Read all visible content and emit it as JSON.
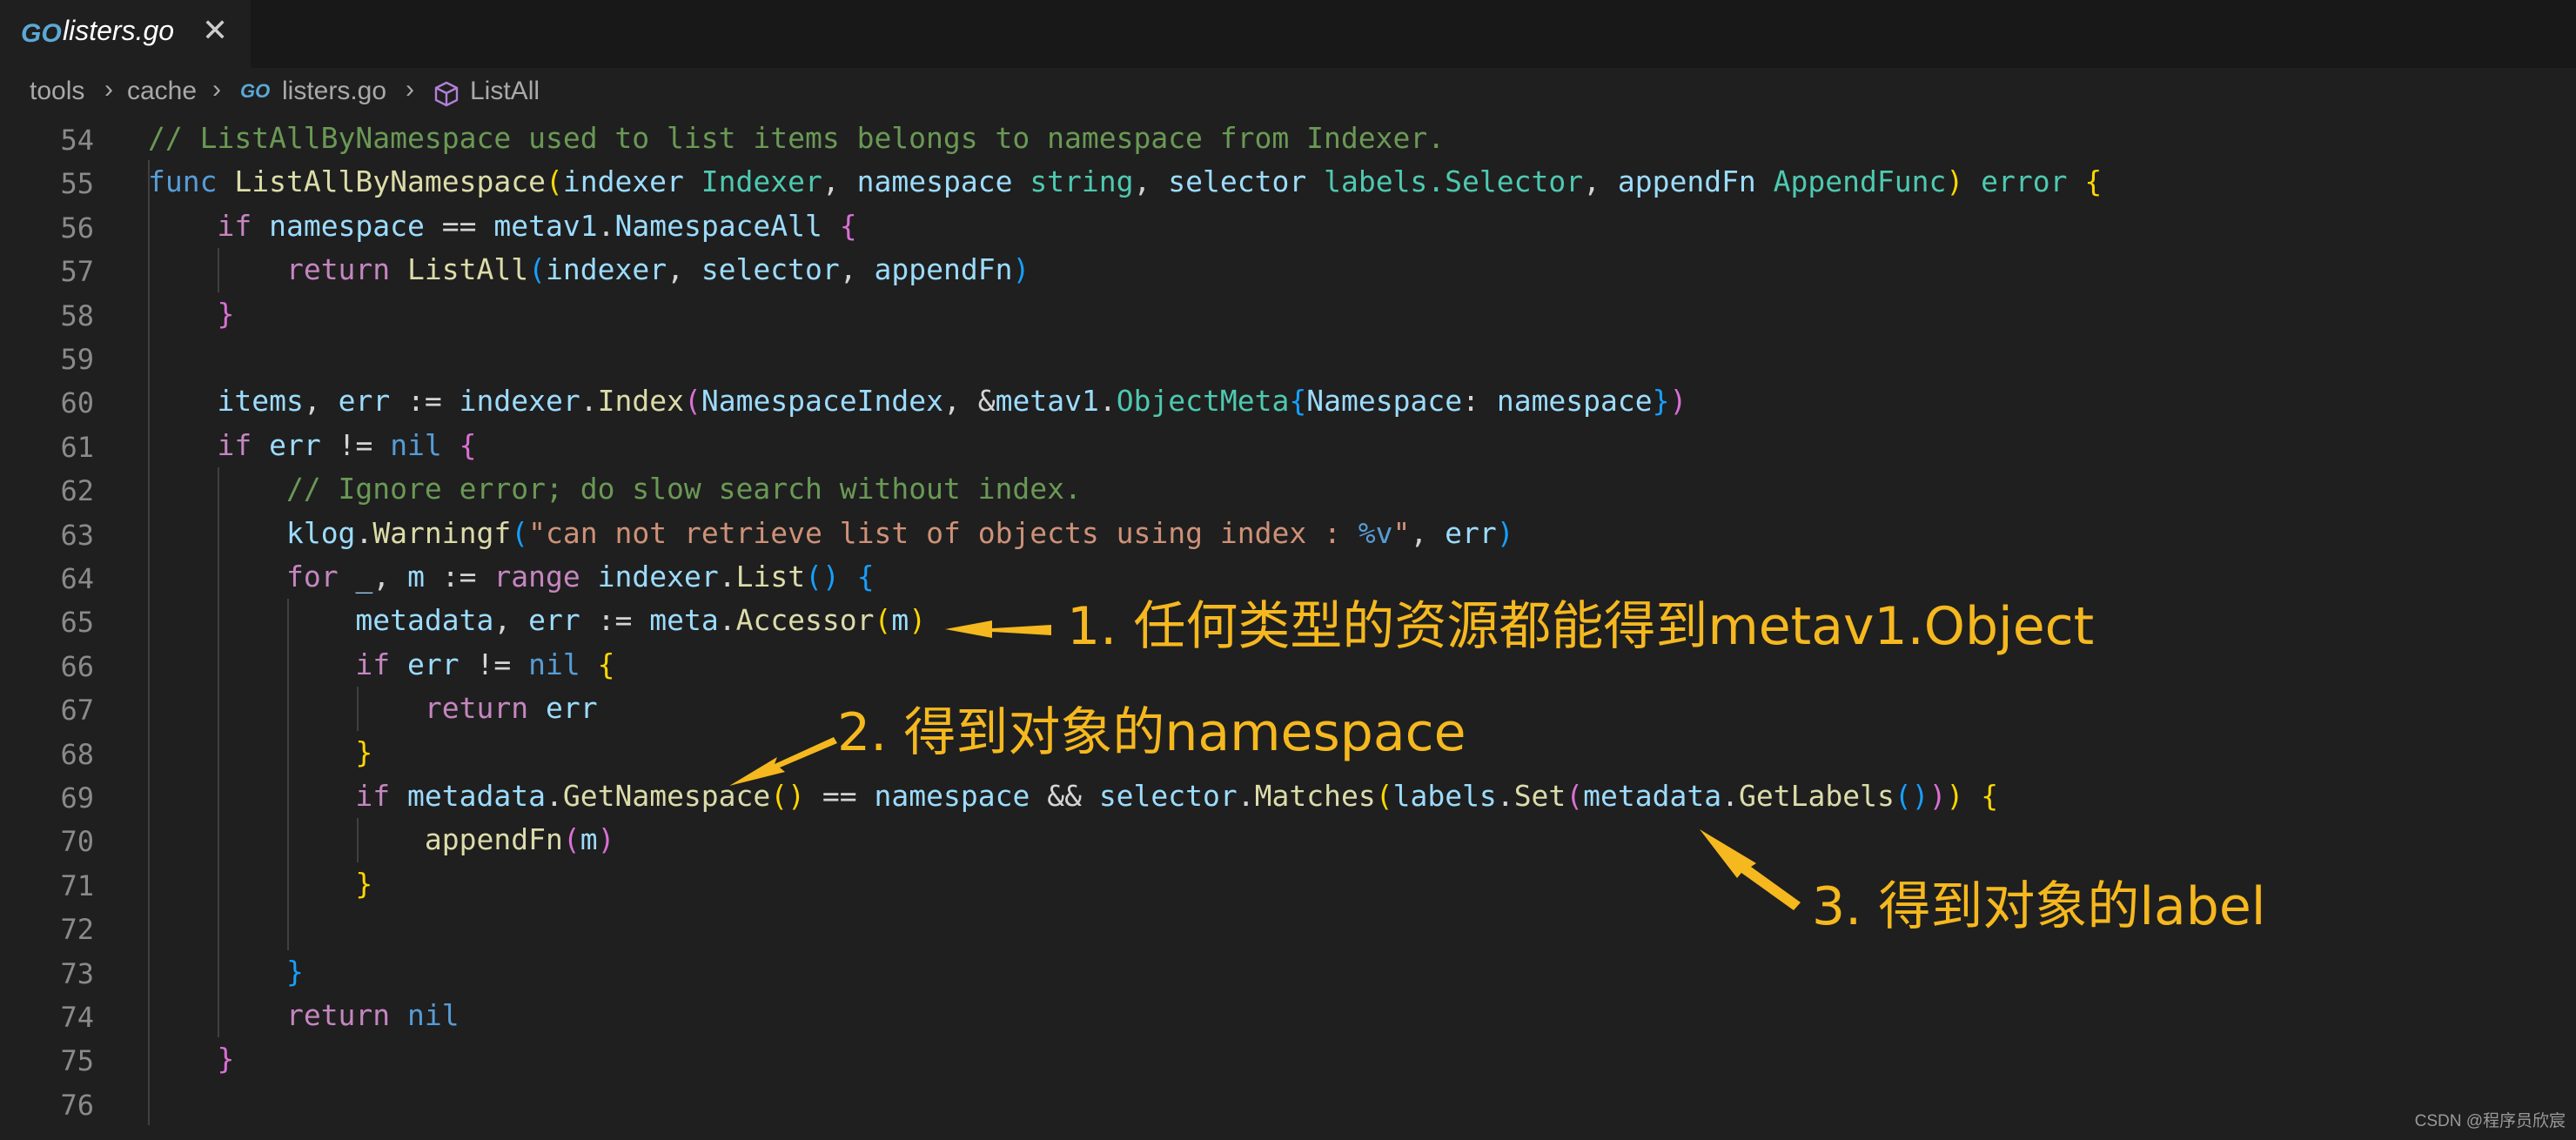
{
  "tab": {
    "icon": "go-file-icon",
    "icon_text": "GO",
    "filename": "listers.go",
    "close": "✕"
  },
  "breadcrumb": {
    "items": [
      "tools",
      "cache",
      "listers.go",
      "ListAll"
    ],
    "separator": "›",
    "go_icon_text": "GO",
    "symbol_icon": "cube-icon"
  },
  "line_numbers": [
    "54",
    "55",
    "56",
    "57",
    "58",
    "59",
    "60",
    "61",
    "62",
    "63",
    "64",
    "65",
    "66",
    "67",
    "68",
    "69",
    "70",
    "71",
    "72",
    "73",
    "74",
    "75",
    "76"
  ],
  "code_lines": [
    [
      [
        "com",
        "// ListAllByNamespace used to list items belongs to namespace from Indexer."
      ]
    ],
    [
      [
        "kw",
        "func "
      ],
      [
        "fn",
        "ListAllByNamespace"
      ],
      [
        "b1",
        "("
      ],
      [
        "var",
        "indexer "
      ],
      [
        "type",
        "Indexer"
      ],
      [
        "txt",
        ", "
      ],
      [
        "var",
        "namespace "
      ],
      [
        "type",
        "string"
      ],
      [
        "txt",
        ", "
      ],
      [
        "var",
        "selector "
      ],
      [
        "type",
        "labels.Selector"
      ],
      [
        "txt",
        ", "
      ],
      [
        "var",
        "appendFn "
      ],
      [
        "type",
        "AppendFunc"
      ],
      [
        "b1",
        ")"
      ],
      [
        "txt",
        " "
      ],
      [
        "type",
        "error"
      ],
      [
        "txt",
        " "
      ],
      [
        "b1",
        "{"
      ]
    ],
    [
      [
        "txt",
        "    "
      ],
      [
        "ctl",
        "if "
      ],
      [
        "var",
        "namespace"
      ],
      [
        "txt",
        " == "
      ],
      [
        "var",
        "metav1"
      ],
      [
        "txt",
        "."
      ],
      [
        "var",
        "NamespaceAll"
      ],
      [
        "txt",
        " "
      ],
      [
        "b2",
        "{"
      ]
    ],
    [
      [
        "txt",
        "        "
      ],
      [
        "ctl",
        "return "
      ],
      [
        "fn",
        "ListAll"
      ],
      [
        "b3",
        "("
      ],
      [
        "var",
        "indexer"
      ],
      [
        "txt",
        ", "
      ],
      [
        "var",
        "selector"
      ],
      [
        "txt",
        ", "
      ],
      [
        "var",
        "appendFn"
      ],
      [
        "b3",
        ")"
      ]
    ],
    [
      [
        "txt",
        "    "
      ],
      [
        "b2",
        "}"
      ]
    ],
    [
      [
        "txt",
        ""
      ]
    ],
    [
      [
        "txt",
        "    "
      ],
      [
        "var",
        "items"
      ],
      [
        "txt",
        ", "
      ],
      [
        "var",
        "err"
      ],
      [
        "txt",
        " := "
      ],
      [
        "var",
        "indexer"
      ],
      [
        "txt",
        "."
      ],
      [
        "fn",
        "Index"
      ],
      [
        "b2",
        "("
      ],
      [
        "var",
        "NamespaceIndex"
      ],
      [
        "txt",
        ", &"
      ],
      [
        "var",
        "metav1"
      ],
      [
        "txt",
        "."
      ],
      [
        "type",
        "ObjectMeta"
      ],
      [
        "b3",
        "{"
      ],
      [
        "var",
        "Namespace"
      ],
      [
        "txt",
        ": "
      ],
      [
        "var",
        "namespace"
      ],
      [
        "b3",
        "}"
      ],
      [
        "b2",
        ")"
      ]
    ],
    [
      [
        "txt",
        "    "
      ],
      [
        "ctl",
        "if "
      ],
      [
        "var",
        "err"
      ],
      [
        "txt",
        " != "
      ],
      [
        "kw",
        "nil"
      ],
      [
        "txt",
        " "
      ],
      [
        "b2",
        "{"
      ]
    ],
    [
      [
        "txt",
        "        "
      ],
      [
        "com",
        "// Ignore error; do slow search without index."
      ]
    ],
    [
      [
        "txt",
        "        "
      ],
      [
        "var",
        "klog"
      ],
      [
        "txt",
        "."
      ],
      [
        "fn",
        "Warningf"
      ],
      [
        "b3",
        "("
      ],
      [
        "str",
        "\"can not retrieve list of objects using index : "
      ],
      [
        "kw",
        "%v"
      ],
      [
        "str",
        "\""
      ],
      [
        "txt",
        ", "
      ],
      [
        "var",
        "err"
      ],
      [
        "b3",
        ")"
      ]
    ],
    [
      [
        "txt",
        "        "
      ],
      [
        "ctl",
        "for "
      ],
      [
        "var",
        "_"
      ],
      [
        "txt",
        ", "
      ],
      [
        "var",
        "m"
      ],
      [
        "txt",
        " := "
      ],
      [
        "ctl",
        "range "
      ],
      [
        "var",
        "indexer"
      ],
      [
        "txt",
        "."
      ],
      [
        "fn",
        "List"
      ],
      [
        "b3",
        "()"
      ],
      [
        "txt",
        " "
      ],
      [
        "b3",
        "{"
      ]
    ],
    [
      [
        "txt",
        "            "
      ],
      [
        "var",
        "metadata"
      ],
      [
        "txt",
        ", "
      ],
      [
        "var",
        "err"
      ],
      [
        "txt",
        " := "
      ],
      [
        "var",
        "meta"
      ],
      [
        "txt",
        "."
      ],
      [
        "fn",
        "Accessor"
      ],
      [
        "b1",
        "("
      ],
      [
        "var",
        "m"
      ],
      [
        "b1",
        ")"
      ]
    ],
    [
      [
        "txt",
        "            "
      ],
      [
        "ctl",
        "if "
      ],
      [
        "var",
        "err"
      ],
      [
        "txt",
        " != "
      ],
      [
        "kw",
        "nil"
      ],
      [
        "txt",
        " "
      ],
      [
        "b1",
        "{"
      ]
    ],
    [
      [
        "txt",
        "                "
      ],
      [
        "ctl",
        "return "
      ],
      [
        "var",
        "err"
      ]
    ],
    [
      [
        "txt",
        "            "
      ],
      [
        "b1",
        "}"
      ]
    ],
    [
      [
        "txt",
        "            "
      ],
      [
        "ctl",
        "if "
      ],
      [
        "var",
        "metadata"
      ],
      [
        "txt",
        "."
      ],
      [
        "fn",
        "GetNamespace"
      ],
      [
        "b1",
        "()"
      ],
      [
        "txt",
        " == "
      ],
      [
        "var",
        "namespace"
      ],
      [
        "txt",
        " && "
      ],
      [
        "var",
        "selector"
      ],
      [
        "txt",
        "."
      ],
      [
        "fn",
        "Matches"
      ],
      [
        "b1",
        "("
      ],
      [
        "var",
        "labels"
      ],
      [
        "txt",
        "."
      ],
      [
        "fn",
        "Set"
      ],
      [
        "b2",
        "("
      ],
      [
        "var",
        "metadata"
      ],
      [
        "txt",
        "."
      ],
      [
        "fn",
        "GetLabels"
      ],
      [
        "b3",
        "()"
      ],
      [
        "b2",
        ")"
      ],
      [
        "b1",
        ")"
      ],
      [
        "txt",
        " "
      ],
      [
        "b1",
        "{"
      ]
    ],
    [
      [
        "txt",
        "                "
      ],
      [
        "fn",
        "appendFn"
      ],
      [
        "b2",
        "("
      ],
      [
        "var",
        "m"
      ],
      [
        "b2",
        ")"
      ]
    ],
    [
      [
        "txt",
        "            "
      ],
      [
        "b1",
        "}"
      ]
    ],
    [
      [
        "txt",
        ""
      ]
    ],
    [
      [
        "txt",
        "        "
      ],
      [
        "b3",
        "}"
      ]
    ],
    [
      [
        "txt",
        "        "
      ],
      [
        "ctl",
        "return "
      ],
      [
        "kw",
        "nil"
      ]
    ],
    [
      [
        "txt",
        "    "
      ],
      [
        "b2",
        "}"
      ]
    ],
    [
      [
        "txt",
        ""
      ]
    ]
  ],
  "annotations": [
    "1. 任何类型的资源都能得到metav1.Object",
    "2. 得到对象的namespace",
    "3. 得到对象的label"
  ],
  "colors": {
    "annotation": "#f5b81e",
    "background": "#1f1f1f"
  },
  "watermark": "CSDN @程序员欣宸"
}
